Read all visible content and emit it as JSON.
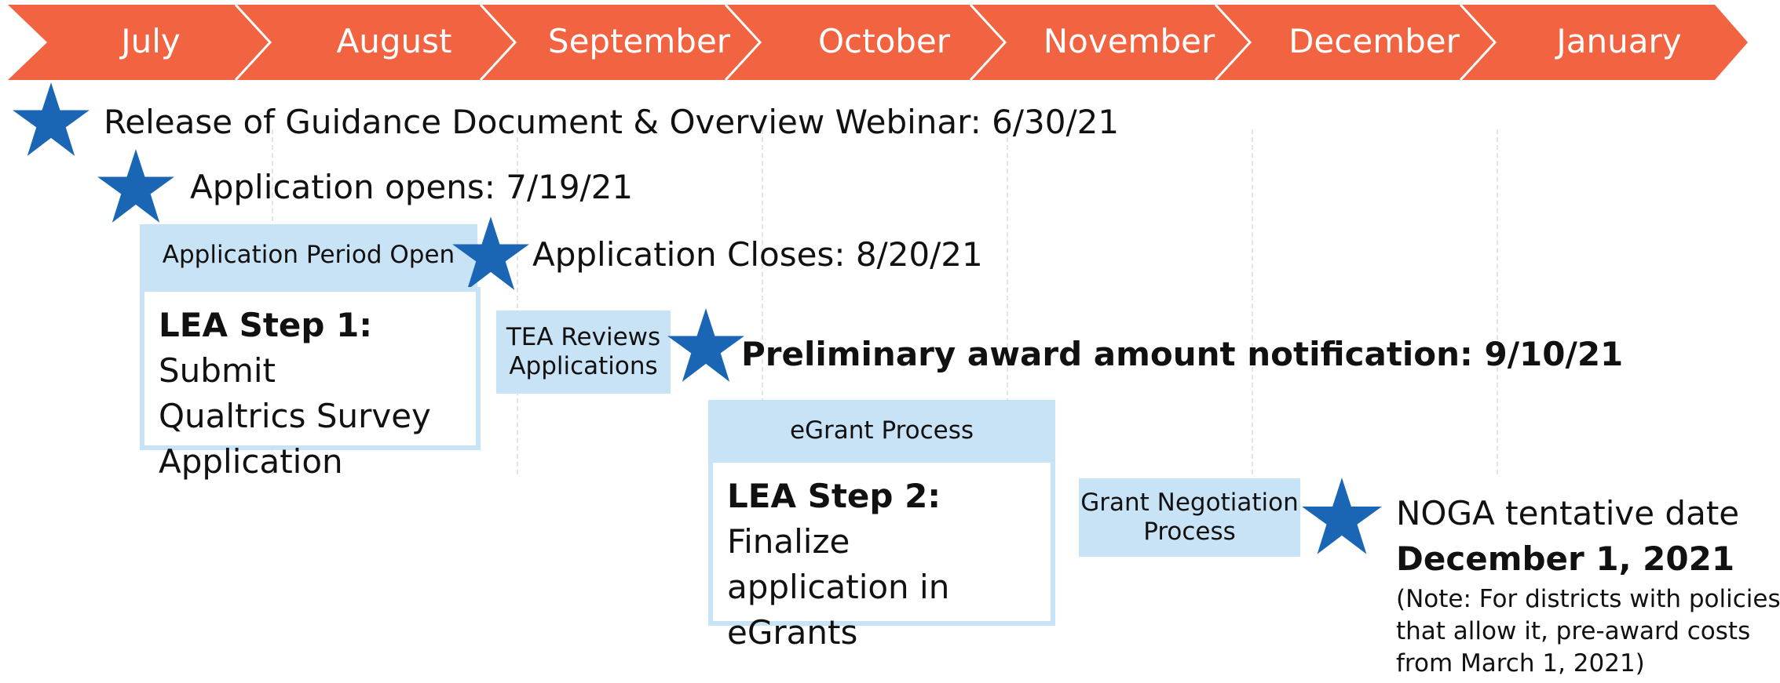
{
  "colors": {
    "banner": "#f26441",
    "star": "#1a66b5",
    "phase_fill": "#c9e3f6"
  },
  "months": [
    "July",
    "August",
    "September",
    "October",
    "November",
    "December",
    "January"
  ],
  "milestones": {
    "guidance": "Release of Guidance Document & Overview Webinar: 6/30/21",
    "opens": "Application opens: 7/19/21",
    "closes": "Application Closes:  8/20/21",
    "preliminary": "Preliminary award amount notification: 9/10/21",
    "noga_line1": "NOGA tentative date",
    "noga_line2": "December 1, 2021",
    "noga_note": [
      "(Note: For districts with policies",
      "that allow it, pre-award costs",
      "from March 1, 2021)"
    ]
  },
  "phases": {
    "application_period": "Application Period Open",
    "tea_reviews": [
      "TEA Reviews",
      "Applications"
    ],
    "egrant_process": "eGrant Process",
    "grant_negotiation": [
      "Grant Negotiation",
      "Process"
    ]
  },
  "steps": {
    "step1": {
      "label": "LEA Step 1:",
      "text": [
        "Submit",
        "Qualtrics Survey",
        "Application"
      ]
    },
    "step2": {
      "label": "LEA Step 2:",
      "text": [
        "Finalize",
        "application in",
        "eGrants"
      ]
    }
  }
}
